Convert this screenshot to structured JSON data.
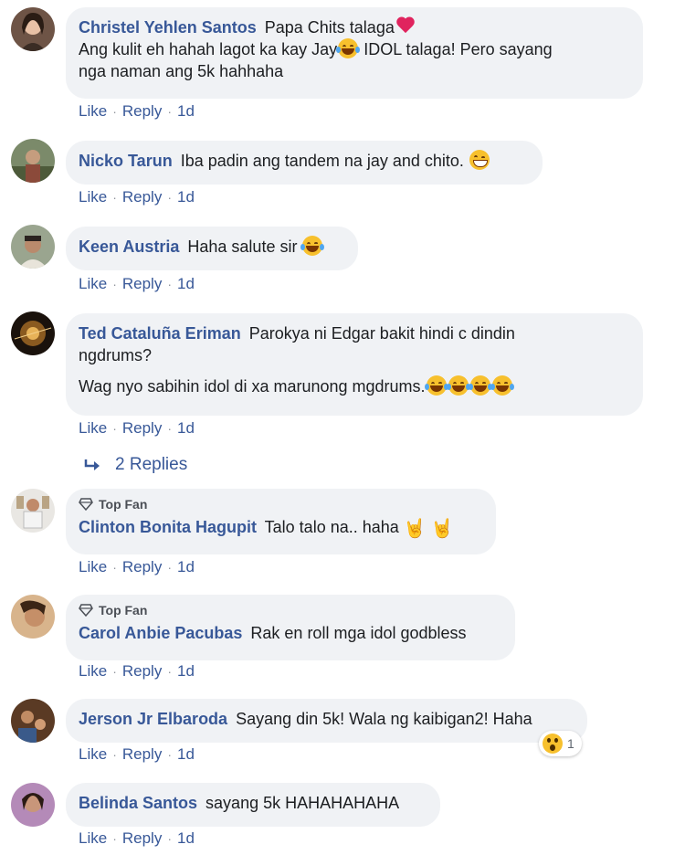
{
  "actions": {
    "like": "Like",
    "reply": "Reply",
    "dot": "·",
    "time": "1d"
  },
  "comments": [
    {
      "author": "Christel Yehlen Santos",
      "line1": "Papa Chits talaga",
      "line2a": "Ang kulit eh hahah lagot ka kay Jay",
      "line2b": " IDOL talaga! Pero sayang",
      "line3": "nga naman ang 5k hahhaha"
    },
    {
      "author": "Nicko Tarun",
      "text": "Iba padin ang tandem na jay and chito."
    },
    {
      "author": "Keen Austria",
      "text": "Haha salute sir"
    },
    {
      "author": "Ted Cataluña Eriman",
      "line1": "Parokya ni Edgar bakit hindi c dindin",
      "line2": "ngdrums?",
      "line3": "Wag nyo sabihin idol di xa marunong mgdrums."
    },
    {
      "badge": "Top Fan",
      "author": "Clinton Bonita Hagupit",
      "text": "Talo talo na.. haha"
    },
    {
      "badge": "Top Fan",
      "author": "Carol Anbie Pacubas",
      "text": "Rak en roll mga idol godbless"
    },
    {
      "author": "Jerson Jr Elbaroda",
      "text": "Sayang din 5k! Wala ng kaibigan2! Haha",
      "reaction_count": "1"
    },
    {
      "author": "Belinda Santos",
      "text": "sayang 5k HAHAHAHAHA"
    }
  ],
  "replies_link": "2 Replies",
  "colors": {
    "link": "#385898",
    "bubble": "#f0f2f5",
    "meta": "#90949c"
  }
}
